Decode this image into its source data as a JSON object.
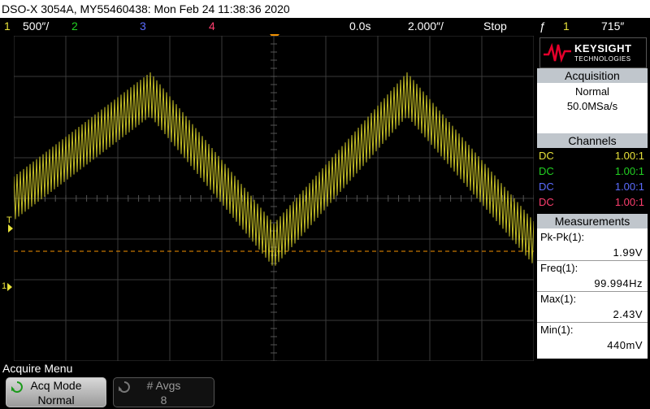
{
  "title_bar": "DSO-X 3054A, MY55460438: Mon Feb 24 11:38:36 2020",
  "status": {
    "ch1_num": "1",
    "ch1_scale": "500″/",
    "ch2_num": "2",
    "ch3_num": "3",
    "ch4_num": "4",
    "time_delay": "0.0s",
    "time_scale": "2.000″/",
    "run_state": "Stop",
    "trig_source": "1",
    "trig_level": "715″"
  },
  "markers": {
    "trigger_level": "T",
    "ground": "1"
  },
  "logo": {
    "brand": "KEYSIGHT",
    "sub": "TECHNOLOGIES"
  },
  "acquisition": {
    "header": "Acquisition",
    "mode": "Normal",
    "rate": "50.0MSa/s"
  },
  "channels": {
    "header": "Channels",
    "rows": [
      {
        "coupling": "DC",
        "ratio": "1.00:1",
        "color": "#c9c400"
      },
      {
        "coupling": "DC",
        "ratio": "1.00:1",
        "color": "#00c000"
      },
      {
        "coupling": "DC",
        "ratio": "1.00:1",
        "color": "#4a58ff"
      },
      {
        "coupling": "DC",
        "ratio": "1.00:1",
        "color": "#ff2a6b"
      }
    ]
  },
  "measurements": {
    "header": "Measurements",
    "items": [
      {
        "label": "Pk-Pk(1):",
        "value": "1.99V"
      },
      {
        "label": "Freq(1):",
        "value": "99.994Hz"
      },
      {
        "label": "Max(1):",
        "value": "2.43V"
      },
      {
        "label": "Min(1):",
        "value": "440mV"
      }
    ]
  },
  "menu": {
    "title": "Acquire Menu",
    "keys": [
      {
        "label": "Acq Mode",
        "value": "Normal"
      },
      {
        "label": "# Avgs",
        "value": "8"
      }
    ]
  },
  "colors": {
    "ch1": "#e8e23a",
    "ch2": "#22d122",
    "ch3": "#5b6cff",
    "ch4": "#ff3f6f",
    "trigger": "#f39200",
    "grid": "#3a3a3a",
    "trace": "#d8d22a"
  }
}
